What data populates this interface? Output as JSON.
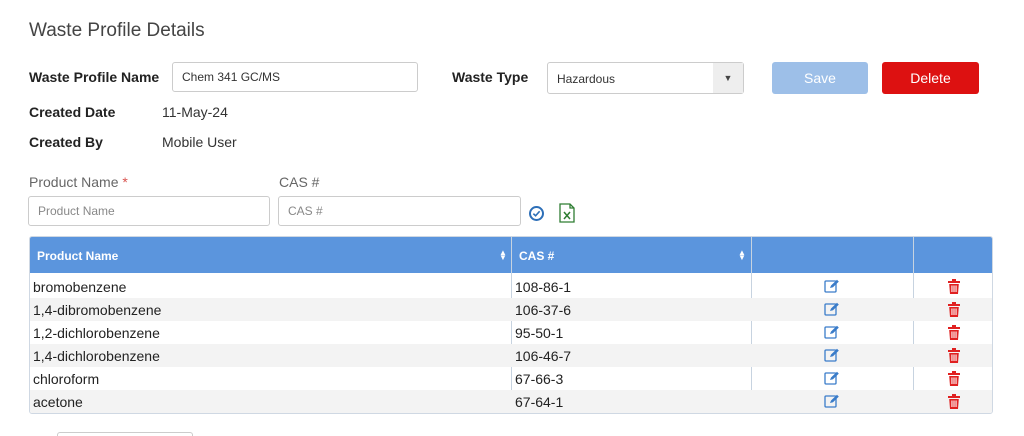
{
  "page": {
    "title": "Waste Profile Details"
  },
  "profile": {
    "name_label": "Waste Profile Name",
    "name_value": "Chem 341 GC/MS",
    "type_label": "Waste Type",
    "type_value": "Hazardous",
    "created_date_label": "Created Date",
    "created_date_value": "11-May-24",
    "created_by_label": "Created By",
    "created_by_value": "Mobile User"
  },
  "actions": {
    "save_label": "Save",
    "delete_label": "Delete"
  },
  "entry": {
    "product_label": "Product Name",
    "required_mark": "*",
    "product_placeholder": "Product Name",
    "cas_label": "CAS #",
    "cas_placeholder": "CAS #"
  },
  "table": {
    "headers": {
      "product": "Product Name",
      "cas": "CAS #"
    },
    "rows": [
      {
        "product": "bromobenzene",
        "cas": "108-86-1"
      },
      {
        "product": "1,4-dibromobenzene",
        "cas": "106-37-6"
      },
      {
        "product": "1,2-dichlorobenzene",
        "cas": "95-50-1"
      },
      {
        "product": "1,4-dichlorobenzene",
        "cas": "106-46-7"
      },
      {
        "product": "chloroform",
        "cas": "67-66-3"
      },
      {
        "product": "acetone",
        "cas": "67-64-1"
      }
    ]
  },
  "icons": {
    "check": "check-circle-icon",
    "excel": "excel-export-icon",
    "edit": "edit-icon",
    "trash": "trash-icon",
    "dropdown": "chevron-down-icon"
  },
  "colors": {
    "header_blue": "#5b95dd",
    "save": "#9dbfe8",
    "delete": "#dd1111",
    "trash": "#e02020",
    "edit": "#3a7cc9",
    "excel": "#2e7d32"
  }
}
